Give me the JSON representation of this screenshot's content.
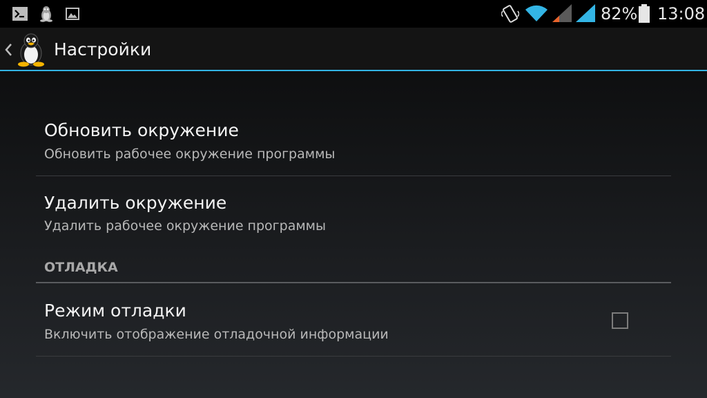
{
  "status_bar": {
    "icons": [
      "terminal-icon",
      "tux-notification-icon",
      "image-icon",
      "vibrate-icon",
      "wifi-icon",
      "signal-icon-1",
      "signal-icon-2",
      "battery-icon"
    ],
    "battery_percent": "82%",
    "time": "13:08"
  },
  "action_bar": {
    "title": "Настройки",
    "app_icon": "tux-penguin-icon",
    "up_icon": "chevron-left-icon",
    "accent_color": "#33b5e5"
  },
  "preferences": {
    "update_env": {
      "title": "Обновить окружение",
      "summary": "Обновить рабочее окружение программы"
    },
    "delete_env": {
      "title": "Удалить окружение",
      "summary": "Удалить рабочее окружение программы"
    },
    "debug_category": {
      "title": "ОТЛАДКА"
    },
    "debug_mode": {
      "title": "Режим отладки",
      "summary": "Включить отображение отладочной информации",
      "checked": false
    }
  }
}
